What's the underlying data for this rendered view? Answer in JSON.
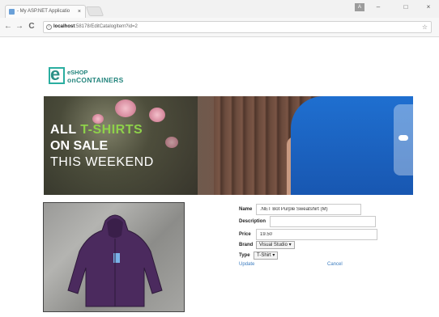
{
  "browser": {
    "tab_title": "- My ASP.NET Applicatio",
    "tab_close": "×",
    "user_badge": "A",
    "minimize": "–",
    "maximize": "□",
    "close": "×",
    "back": "←",
    "forward": "→",
    "reload": "C",
    "url_host": "localhost",
    "url_path": ":58178/EditCatalogItem?id=2",
    "star": "☆"
  },
  "logo": {
    "letter": "e",
    "line1": "eSHOP",
    "line2": "onCONTAINERS"
  },
  "banner": {
    "line1_prefix": "ALL ",
    "line1_highlight": "T-SHIRTS",
    "line2": "ON SALE",
    "line3": "THIS WEEKEND"
  },
  "form": {
    "name_label": "Name",
    "name_value": ".NET Bot Purple Sweatshirt (M)",
    "description_label": "Description",
    "description_value": "",
    "price_label": "Price",
    "price_value": "19.50",
    "brand_label": "Brand",
    "brand_value": "Visual Studio",
    "type_label": "Type",
    "type_value": "T-Shirt",
    "update_label": "Update",
    "cancel_label": "Cancel"
  },
  "colors": {
    "brand": "#24857d",
    "banner_highlight": "#8ed14a",
    "link": "#3a7bbf",
    "product": "#4b2a5e"
  }
}
